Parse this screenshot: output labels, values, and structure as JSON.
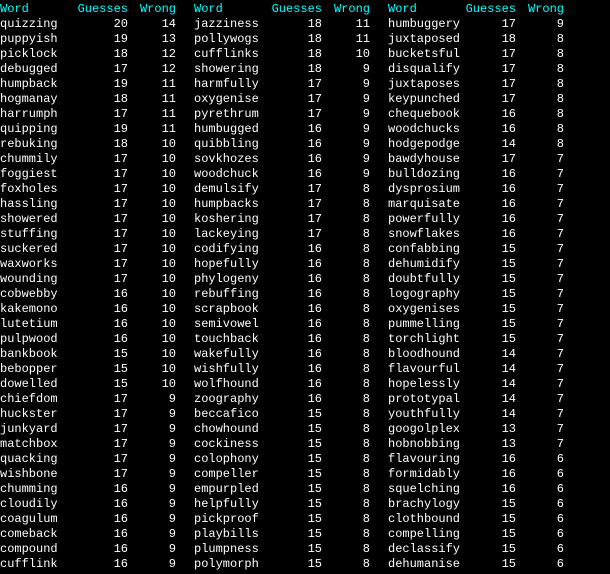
{
  "headers": {
    "word": "Word",
    "guesses": "Guesses",
    "wrong": "Wrong"
  },
  "columns": [
    [
      {
        "word": "quizzing",
        "guesses": 20,
        "wrong": 14
      },
      {
        "word": "puppyish",
        "guesses": 19,
        "wrong": 13
      },
      {
        "word": "picklock",
        "guesses": 18,
        "wrong": 12
      },
      {
        "word": "debugged",
        "guesses": 17,
        "wrong": 12
      },
      {
        "word": "humpback",
        "guesses": 19,
        "wrong": 11
      },
      {
        "word": "hogmanay",
        "guesses": 18,
        "wrong": 11
      },
      {
        "word": "harrumph",
        "guesses": 17,
        "wrong": 11
      },
      {
        "word": "quipping",
        "guesses": 19,
        "wrong": 11
      },
      {
        "word": "rebuking",
        "guesses": 18,
        "wrong": 10
      },
      {
        "word": "chummily",
        "guesses": 17,
        "wrong": 10
      },
      {
        "word": "foggiest",
        "guesses": 17,
        "wrong": 10
      },
      {
        "word": "foxholes",
        "guesses": 17,
        "wrong": 10
      },
      {
        "word": "hassling",
        "guesses": 17,
        "wrong": 10
      },
      {
        "word": "showered",
        "guesses": 17,
        "wrong": 10
      },
      {
        "word": "stuffing",
        "guesses": 17,
        "wrong": 10
      },
      {
        "word": "suckered",
        "guesses": 17,
        "wrong": 10
      },
      {
        "word": "waxworks",
        "guesses": 17,
        "wrong": 10
      },
      {
        "word": "wounding",
        "guesses": 17,
        "wrong": 10
      },
      {
        "word": "cobwebby",
        "guesses": 16,
        "wrong": 10
      },
      {
        "word": "kakemono",
        "guesses": 16,
        "wrong": 10
      },
      {
        "word": "lutetium",
        "guesses": 16,
        "wrong": 10
      },
      {
        "word": "pulpwood",
        "guesses": 16,
        "wrong": 10
      },
      {
        "word": "bankbook",
        "guesses": 15,
        "wrong": 10
      },
      {
        "word": "bebopper",
        "guesses": 15,
        "wrong": 10
      },
      {
        "word": "dowelled",
        "guesses": 15,
        "wrong": 10
      },
      {
        "word": "chiefdom",
        "guesses": 17,
        "wrong": 9
      },
      {
        "word": "huckster",
        "guesses": 17,
        "wrong": 9
      },
      {
        "word": "junkyard",
        "guesses": 17,
        "wrong": 9
      },
      {
        "word": "matchbox",
        "guesses": 17,
        "wrong": 9
      },
      {
        "word": "quacking",
        "guesses": 17,
        "wrong": 9
      },
      {
        "word": "wishbone",
        "guesses": 17,
        "wrong": 9
      },
      {
        "word": "chumming",
        "guesses": 16,
        "wrong": 9
      },
      {
        "word": "cloudily",
        "guesses": 16,
        "wrong": 9
      },
      {
        "word": "coagulum",
        "guesses": 16,
        "wrong": 9
      },
      {
        "word": "comeback",
        "guesses": 16,
        "wrong": 9
      },
      {
        "word": "compound",
        "guesses": 16,
        "wrong": 9
      },
      {
        "word": "cufflink",
        "guesses": 16,
        "wrong": 9
      }
    ],
    [
      {
        "word": "jazziness",
        "guesses": 18,
        "wrong": 11
      },
      {
        "word": "pollywogs",
        "guesses": 18,
        "wrong": 11
      },
      {
        "word": "cufflinks",
        "guesses": 18,
        "wrong": 10
      },
      {
        "word": "showering",
        "guesses": 18,
        "wrong": 9
      },
      {
        "word": "harmfully",
        "guesses": 17,
        "wrong": 9
      },
      {
        "word": "oxygenise",
        "guesses": 17,
        "wrong": 9
      },
      {
        "word": "pyrethrum",
        "guesses": 17,
        "wrong": 9
      },
      {
        "word": "humbugged",
        "guesses": 16,
        "wrong": 9
      },
      {
        "word": "quibbling",
        "guesses": 16,
        "wrong": 9
      },
      {
        "word": "sovkhozes",
        "guesses": 16,
        "wrong": 9
      },
      {
        "word": "woodchuck",
        "guesses": 16,
        "wrong": 9
      },
      {
        "word": "demulsify",
        "guesses": 17,
        "wrong": 8
      },
      {
        "word": "humpbacks",
        "guesses": 17,
        "wrong": 8
      },
      {
        "word": "koshering",
        "guesses": 17,
        "wrong": 8
      },
      {
        "word": "lackeying",
        "guesses": 17,
        "wrong": 8
      },
      {
        "word": "codifying",
        "guesses": 16,
        "wrong": 8
      },
      {
        "word": "hopefully",
        "guesses": 16,
        "wrong": 8
      },
      {
        "word": "phylogeny",
        "guesses": 16,
        "wrong": 8
      },
      {
        "word": "rebuffing",
        "guesses": 16,
        "wrong": 8
      },
      {
        "word": "scrapbook",
        "guesses": 16,
        "wrong": 8
      },
      {
        "word": "semivowel",
        "guesses": 16,
        "wrong": 8
      },
      {
        "word": "touchback",
        "guesses": 16,
        "wrong": 8
      },
      {
        "word": "wakefully",
        "guesses": 16,
        "wrong": 8
      },
      {
        "word": "wishfully",
        "guesses": 16,
        "wrong": 8
      },
      {
        "word": "wolfhound",
        "guesses": 16,
        "wrong": 8
      },
      {
        "word": "zoography",
        "guesses": 16,
        "wrong": 8
      },
      {
        "word": "beccafico",
        "guesses": 15,
        "wrong": 8
      },
      {
        "word": "chowhound",
        "guesses": 15,
        "wrong": 8
      },
      {
        "word": "cockiness",
        "guesses": 15,
        "wrong": 8
      },
      {
        "word": "colophony",
        "guesses": 15,
        "wrong": 8
      },
      {
        "word": "compeller",
        "guesses": 15,
        "wrong": 8
      },
      {
        "word": "empurpled",
        "guesses": 15,
        "wrong": 8
      },
      {
        "word": "helpfully",
        "guesses": 15,
        "wrong": 8
      },
      {
        "word": "pickproof",
        "guesses": 15,
        "wrong": 8
      },
      {
        "word": "playbills",
        "guesses": 15,
        "wrong": 8
      },
      {
        "word": "plumpness",
        "guesses": 15,
        "wrong": 8
      },
      {
        "word": "polymorph",
        "guesses": 15,
        "wrong": 8
      }
    ],
    [
      {
        "word": "humbuggery",
        "guesses": 17,
        "wrong": 9
      },
      {
        "word": "juxtaposed",
        "guesses": 18,
        "wrong": 8
      },
      {
        "word": "bucketsful",
        "guesses": 17,
        "wrong": 8
      },
      {
        "word": "disqualify",
        "guesses": 17,
        "wrong": 8
      },
      {
        "word": "juxtaposes",
        "guesses": 17,
        "wrong": 8
      },
      {
        "word": "keypunched",
        "guesses": 17,
        "wrong": 8
      },
      {
        "word": "chequebook",
        "guesses": 16,
        "wrong": 8
      },
      {
        "word": "woodchucks",
        "guesses": 16,
        "wrong": 8
      },
      {
        "word": "hodgepodge",
        "guesses": 14,
        "wrong": 8
      },
      {
        "word": "bawdyhouse",
        "guesses": 17,
        "wrong": 7
      },
      {
        "word": "bulldozing",
        "guesses": 16,
        "wrong": 7
      },
      {
        "word": "dysprosium",
        "guesses": 16,
        "wrong": 7
      },
      {
        "word": "marquisate",
        "guesses": 16,
        "wrong": 7
      },
      {
        "word": "powerfully",
        "guesses": 16,
        "wrong": 7
      },
      {
        "word": "snowflakes",
        "guesses": 16,
        "wrong": 7
      },
      {
        "word": "confabbing",
        "guesses": 15,
        "wrong": 7
      },
      {
        "word": "dehumidify",
        "guesses": 15,
        "wrong": 7
      },
      {
        "word": "doubtfully",
        "guesses": 15,
        "wrong": 7
      },
      {
        "word": "logography",
        "guesses": 15,
        "wrong": 7
      },
      {
        "word": "oxygenises",
        "guesses": 15,
        "wrong": 7
      },
      {
        "word": "pummelling",
        "guesses": 15,
        "wrong": 7
      },
      {
        "word": "torchlight",
        "guesses": 15,
        "wrong": 7
      },
      {
        "word": "bloodhound",
        "guesses": 14,
        "wrong": 7
      },
      {
        "word": "flavourful",
        "guesses": 14,
        "wrong": 7
      },
      {
        "word": "hopelessly",
        "guesses": 14,
        "wrong": 7
      },
      {
        "word": "prototypal",
        "guesses": 14,
        "wrong": 7
      },
      {
        "word": "youthfully",
        "guesses": 14,
        "wrong": 7
      },
      {
        "word": "googolplex",
        "guesses": 13,
        "wrong": 7
      },
      {
        "word": "hobnobbing",
        "guesses": 13,
        "wrong": 7
      },
      {
        "word": "flavouring",
        "guesses": 16,
        "wrong": 6
      },
      {
        "word": "formidably",
        "guesses": 16,
        "wrong": 6
      },
      {
        "word": "squelching",
        "guesses": 16,
        "wrong": 6
      },
      {
        "word": "brachylogy",
        "guesses": 15,
        "wrong": 6
      },
      {
        "word": "clothbound",
        "guesses": 15,
        "wrong": 6
      },
      {
        "word": "compelling",
        "guesses": 15,
        "wrong": 6
      },
      {
        "word": "declassify",
        "guesses": 15,
        "wrong": 6
      },
      {
        "word": "dehumanise",
        "guesses": 15,
        "wrong": 6
      }
    ]
  ]
}
